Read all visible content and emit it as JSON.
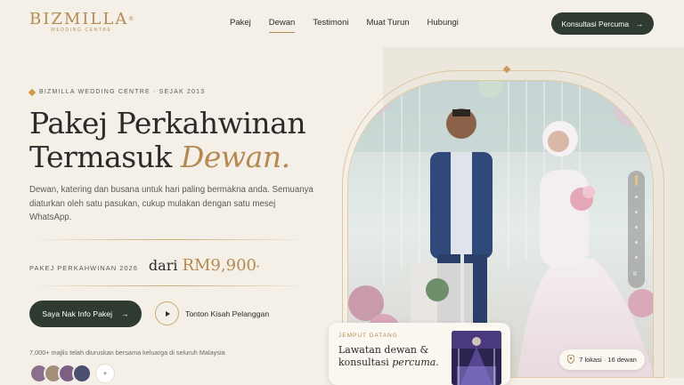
{
  "brand": {
    "name": "BIZMILLA",
    "reg": "®",
    "sub": "WEDDING CENTRE"
  },
  "nav": {
    "items": [
      {
        "label": "Pakej",
        "active": false
      },
      {
        "label": "Dewan",
        "active": true
      },
      {
        "label": "Testimoni",
        "active": false
      },
      {
        "label": "Muat Turun",
        "active": false
      },
      {
        "label": "Hubungi",
        "active": false
      }
    ],
    "cta": "Konsultasi Percuma"
  },
  "hero": {
    "eyebrow": "BIZMILLA WEDDING CENTRE · SEJAK 2013",
    "title_line1": "Pakej Perkahwinan",
    "title_line2": "Termasuk",
    "title_accent": "Dewan.",
    "description": "Dewan, katering dan busana untuk hari paling bermakna anda. Semuanya diaturkan oleh satu pasukan, cukup mulakan dengan satu mesej WhatsApp.",
    "price_label": "PAKEJ PERKAHWINAN 2026",
    "price_prefix": "dari",
    "price_amount": "RM9,900",
    "price_asterisk": "*",
    "primary_cta": "Saya Nak Info Pakej",
    "video_cta": "Tonton Kisah Pelanggan",
    "social_proof": "7,000+ majlis telah diuruskan bersama keluarga di seluruh Malaysia",
    "avatar_more": "+"
  },
  "card": {
    "eyebrow": "JEMPUT DATANG",
    "text_main": "Lawatan dewan &",
    "text_line2": "konsultasi",
    "text_accent": "percuma."
  },
  "location_pill": "7 lokasi · 16 dewan",
  "slider": {
    "pause": "II"
  },
  "colors": {
    "accent": "#b58a52",
    "dark_button": "#2f3b31",
    "background": "#f4f0e8",
    "panel": "#ebe7dc"
  }
}
